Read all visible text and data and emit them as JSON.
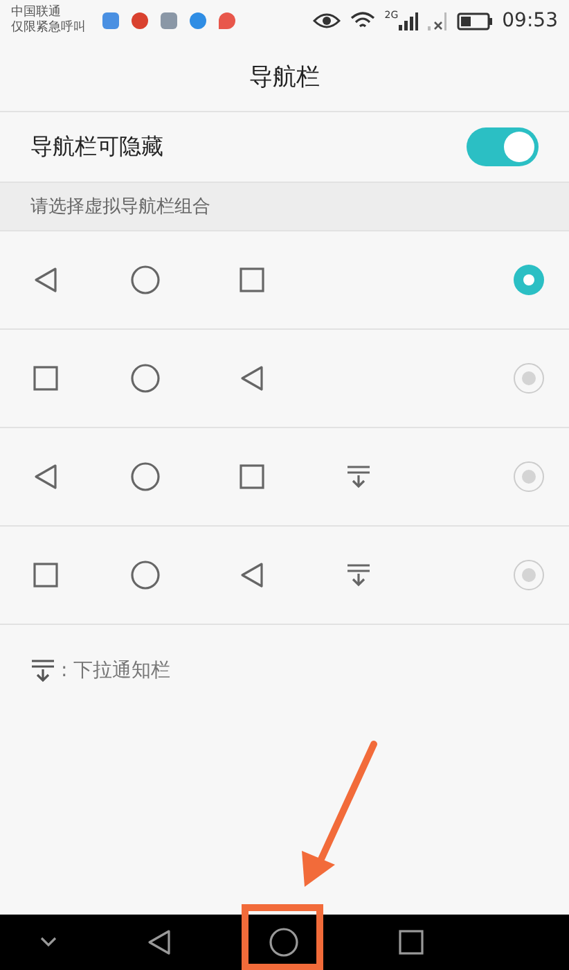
{
  "status_bar": {
    "carrier": "中国联通",
    "carrier_note": "仅限紧急呼叫",
    "network": "2G",
    "time": "09:53"
  },
  "header": {
    "title": "导航栏"
  },
  "toggle": {
    "label": "导航栏可隐藏",
    "on": true
  },
  "section": {
    "title": "请选择虚拟导航栏组合"
  },
  "options": [
    {
      "selected": true,
      "keys": [
        {
          "kind": "back"
        },
        {
          "kind": "home"
        },
        {
          "kind": "recent"
        }
      ]
    },
    {
      "selected": false,
      "keys": [
        {
          "kind": "recent"
        },
        {
          "kind": "home"
        },
        {
          "kind": "back"
        }
      ]
    },
    {
      "selected": false,
      "keys": [
        {
          "kind": "back"
        },
        {
          "kind": "home"
        },
        {
          "kind": "recent"
        },
        {
          "kind": "notify"
        }
      ]
    },
    {
      "selected": false,
      "keys": [
        {
          "kind": "recent"
        },
        {
          "kind": "home"
        },
        {
          "kind": "back"
        },
        {
          "kind": "notify"
        }
      ]
    }
  ],
  "legend": {
    "text": ": 下拉通知栏"
  },
  "nav_bar": {
    "keys": [
      {
        "kind": "hide"
      },
      {
        "kind": "back"
      },
      {
        "kind": "home"
      },
      {
        "kind": "recent"
      }
    ]
  }
}
